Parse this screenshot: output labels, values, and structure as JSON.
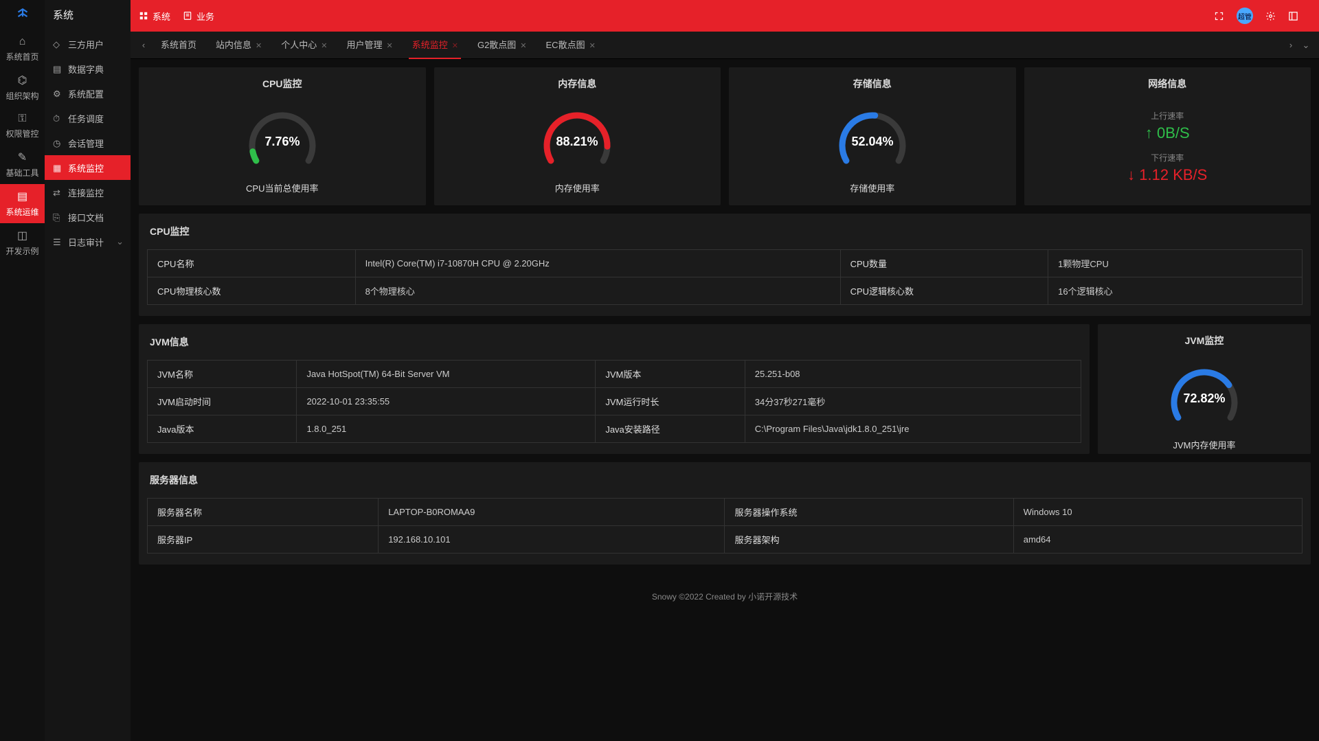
{
  "sidebar_title": "系统",
  "rail_items": [
    {
      "l": "系统首页"
    },
    {
      "l": "组织架构"
    },
    {
      "l": "权限管控"
    },
    {
      "l": "基础工具"
    },
    {
      "l": "系统运维"
    },
    {
      "l": "开发示例"
    }
  ],
  "menu_items": [
    {
      "l": "三方用户"
    },
    {
      "l": "数据字典"
    },
    {
      "l": "系统配置"
    },
    {
      "l": "任务调度"
    },
    {
      "l": "会话管理"
    },
    {
      "l": "系统监控",
      "active": true
    },
    {
      "l": "连接监控"
    },
    {
      "l": "接口文档"
    },
    {
      "l": "日志审计",
      "children": true
    }
  ],
  "topbar": {
    "system": "系统",
    "biz": "业务",
    "avatar": "超管"
  },
  "tabs": [
    {
      "l": "系统首页"
    },
    {
      "l": "站内信息",
      "c": true
    },
    {
      "l": "个人中心",
      "c": true
    },
    {
      "l": "用户管理",
      "c": true
    },
    {
      "l": "系统监控",
      "c": true,
      "active": true
    },
    {
      "l": "G2散点图",
      "c": true
    },
    {
      "l": "EC散点图",
      "c": true
    }
  ],
  "gauges": {
    "cpu": {
      "title": "CPU监控",
      "value": "7.76%",
      "label": "CPU当前总使用率",
      "pct": 7.76,
      "color": "#2fbf4a"
    },
    "mem": {
      "title": "内存信息",
      "value": "88.21%",
      "label": "内存使用率",
      "pct": 88.21,
      "color": "#e62129"
    },
    "disk": {
      "title": "存储信息",
      "value": "52.04%",
      "label": "存储使用率",
      "pct": 52.04,
      "color": "#2a7be5"
    },
    "jvm": {
      "title": "JVM监控",
      "value": "72.82%",
      "label": "JVM内存使用率",
      "pct": 72.82,
      "color": "#2a7be5"
    }
  },
  "net": {
    "title": "网络信息",
    "up_l": "上行速率",
    "up_v": "0B/S",
    "down_l": "下行速率",
    "down_v": "1.12 KB/S"
  },
  "cpu_panel": {
    "title": "CPU监控",
    "rows": [
      [
        "CPU名称",
        "Intel(R) Core(TM) i7-10870H CPU @ 2.20GHz",
        "CPU数量",
        "1颗物理CPU"
      ],
      [
        "CPU物理核心数",
        "8个物理核心",
        "CPU逻辑核心数",
        "16个逻辑核心"
      ]
    ]
  },
  "jvm_panel": {
    "title": "JVM信息",
    "rows": [
      [
        "JVM名称",
        "Java HotSpot(TM) 64-Bit Server VM",
        "JVM版本",
        "25.251-b08"
      ],
      [
        "JVM启动时间",
        "2022-10-01 23:35:55",
        "JVM运行时长",
        "34分37秒271毫秒"
      ],
      [
        "Java版本",
        "1.8.0_251",
        "Java安装路径",
        "C:\\Program Files\\Java\\jdk1.8.0_251\\jre"
      ]
    ]
  },
  "srv_panel": {
    "title": "服务器信息",
    "rows": [
      [
        "服务器名称",
        "LAPTOP-B0ROMAA9",
        "服务器操作系统",
        "Windows 10"
      ],
      [
        "服务器IP",
        "192.168.10.101",
        "服务器架构",
        "amd64"
      ]
    ]
  },
  "footer": "Snowy ©2022 Created by 小诺开源技术"
}
